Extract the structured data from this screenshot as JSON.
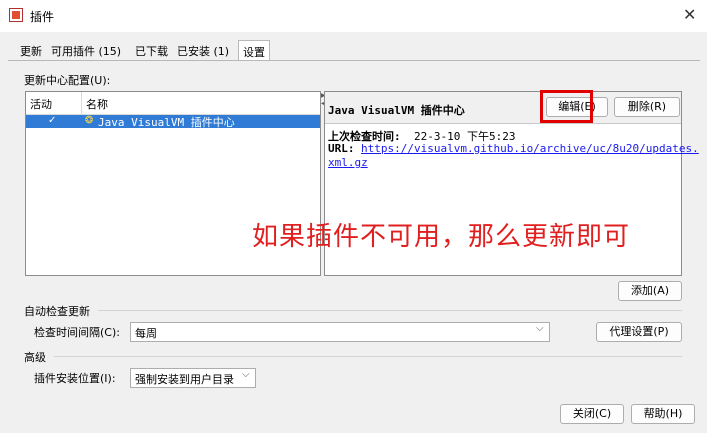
{
  "window": {
    "title": "插件",
    "close_glyph": "✕",
    "app_icon": "plugin-app-icon"
  },
  "tabs": [
    {
      "label": "更新"
    },
    {
      "label": "可用插件 (15)"
    },
    {
      "label": "已下载"
    },
    {
      "label": "已安装 (1)"
    },
    {
      "label": "设置",
      "active": true
    }
  ],
  "settings": {
    "update_center_label": "更新中心配置(U):",
    "table": {
      "headers": [
        "活动",
        "名称"
      ],
      "rows": [
        {
          "active_mark": "✓",
          "icon": "visualvm-icon",
          "name": "Java VisualVM 插件中心",
          "selected": true
        }
      ]
    },
    "detail": {
      "title": "Java VisualVM 插件中心",
      "edit_label": "编辑(E)",
      "delete_label": "删除(R)",
      "last_check_label": "上次检查时间:",
      "last_check_value": "22-3-10 下午5:23",
      "url_label": "URL:",
      "url_line1": "https://visualvm.github.io/archive/uc/8u20/updates.",
      "url_line2": "xml.gz"
    },
    "add_label": "添加(A)",
    "auto_check": {
      "section": "自动检查更新",
      "interval_label": "检查时间间隔(C):",
      "interval_value": "每周",
      "proxy_label": "代理设置(P)"
    },
    "advanced": {
      "section": "高级",
      "install_label": "插件安装位置(I):",
      "install_value": "强制安装到用户目录"
    }
  },
  "annotation": {
    "text": "如果插件不可用，那么更新即可",
    "color": "#e02020"
  },
  "footer": {
    "close_label": "关闭(C)",
    "help_label": "帮助(H)"
  },
  "colors": {
    "selection": "#2f7bd6",
    "highlight_box": "#e00000",
    "link": "#1a1aee"
  }
}
